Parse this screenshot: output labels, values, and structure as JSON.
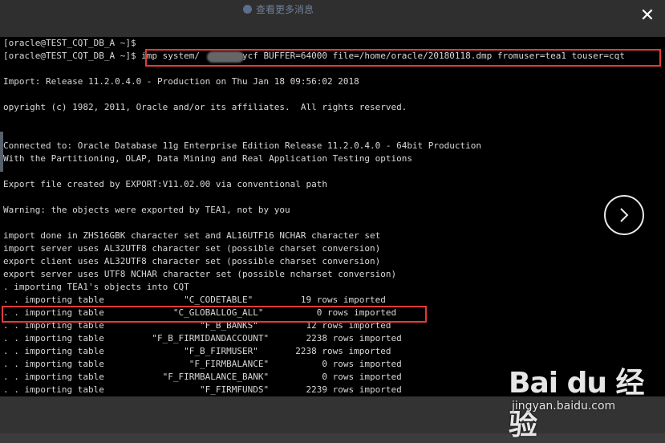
{
  "top_hint": "查看更多消息",
  "close_label": "✕",
  "next_label": "›",
  "watermark": {
    "logo": "Bai du 经验",
    "url": "jingyan.baidu.com"
  },
  "terminal": {
    "lines": [
      "[oracle@TEST_CQT_DB_A ~]$",
      "[oracle@TEST_CQT_DB_A ~]$ imp system/      e@ycf BUFFER=64000 file=/home/oracle/20180118.dmp fromuser=tea1 touser=cqt",
      "",
      "Import: Release 11.2.0.4.0 - Production on Thu Jan 18 09:56:02 2018",
      "",
      "opyright (c) 1982, 2011, Oracle and/or its affiliates.  All rights reserved.",
      "",
      "",
      "Connected to: Oracle Database 11g Enterprise Edition Release 11.2.0.4.0 - 64bit Production",
      "With the Partitioning, OLAP, Data Mining and Real Application Testing options",
      "",
      "Export file created by EXPORT:V11.02.00 via conventional path",
      "",
      "Warning: the objects were exported by TEA1, not by you",
      "",
      "import done in ZHS16GBK character set and AL16UTF16 NCHAR character set",
      "import server uses AL32UTF8 character set (possible charset conversion)",
      "export client uses AL32UTF8 character set (possible charset conversion)",
      "export server uses UTF8 NCHAR character set (possible ncharset conversion)",
      ". importing TEA1's objects into CQT",
      ". . importing table               \"C_CODETABLE\"         19 rows imported",
      ". . importing table             \"C_GLOBALLOG_ALL\"          0 rows imported",
      ". . importing table                  \"F_B_BANKS\"         12 rows imported",
      ". . importing table         \"F_B_FIRMIDANDACCOUNT\"       2238 rows imported",
      ". . importing table               \"F_B_FIRMUSER\"       2238 rows imported",
      ". . importing table                \"F_FIRMBALANCE\"          0 rows imported",
      ". . importing table           \"F_FIRMBALANCE_BANK\"          0 rows imported",
      ". . importing table                  \"F_FIRMFUNDS\"       2239 rows imported"
    ]
  }
}
